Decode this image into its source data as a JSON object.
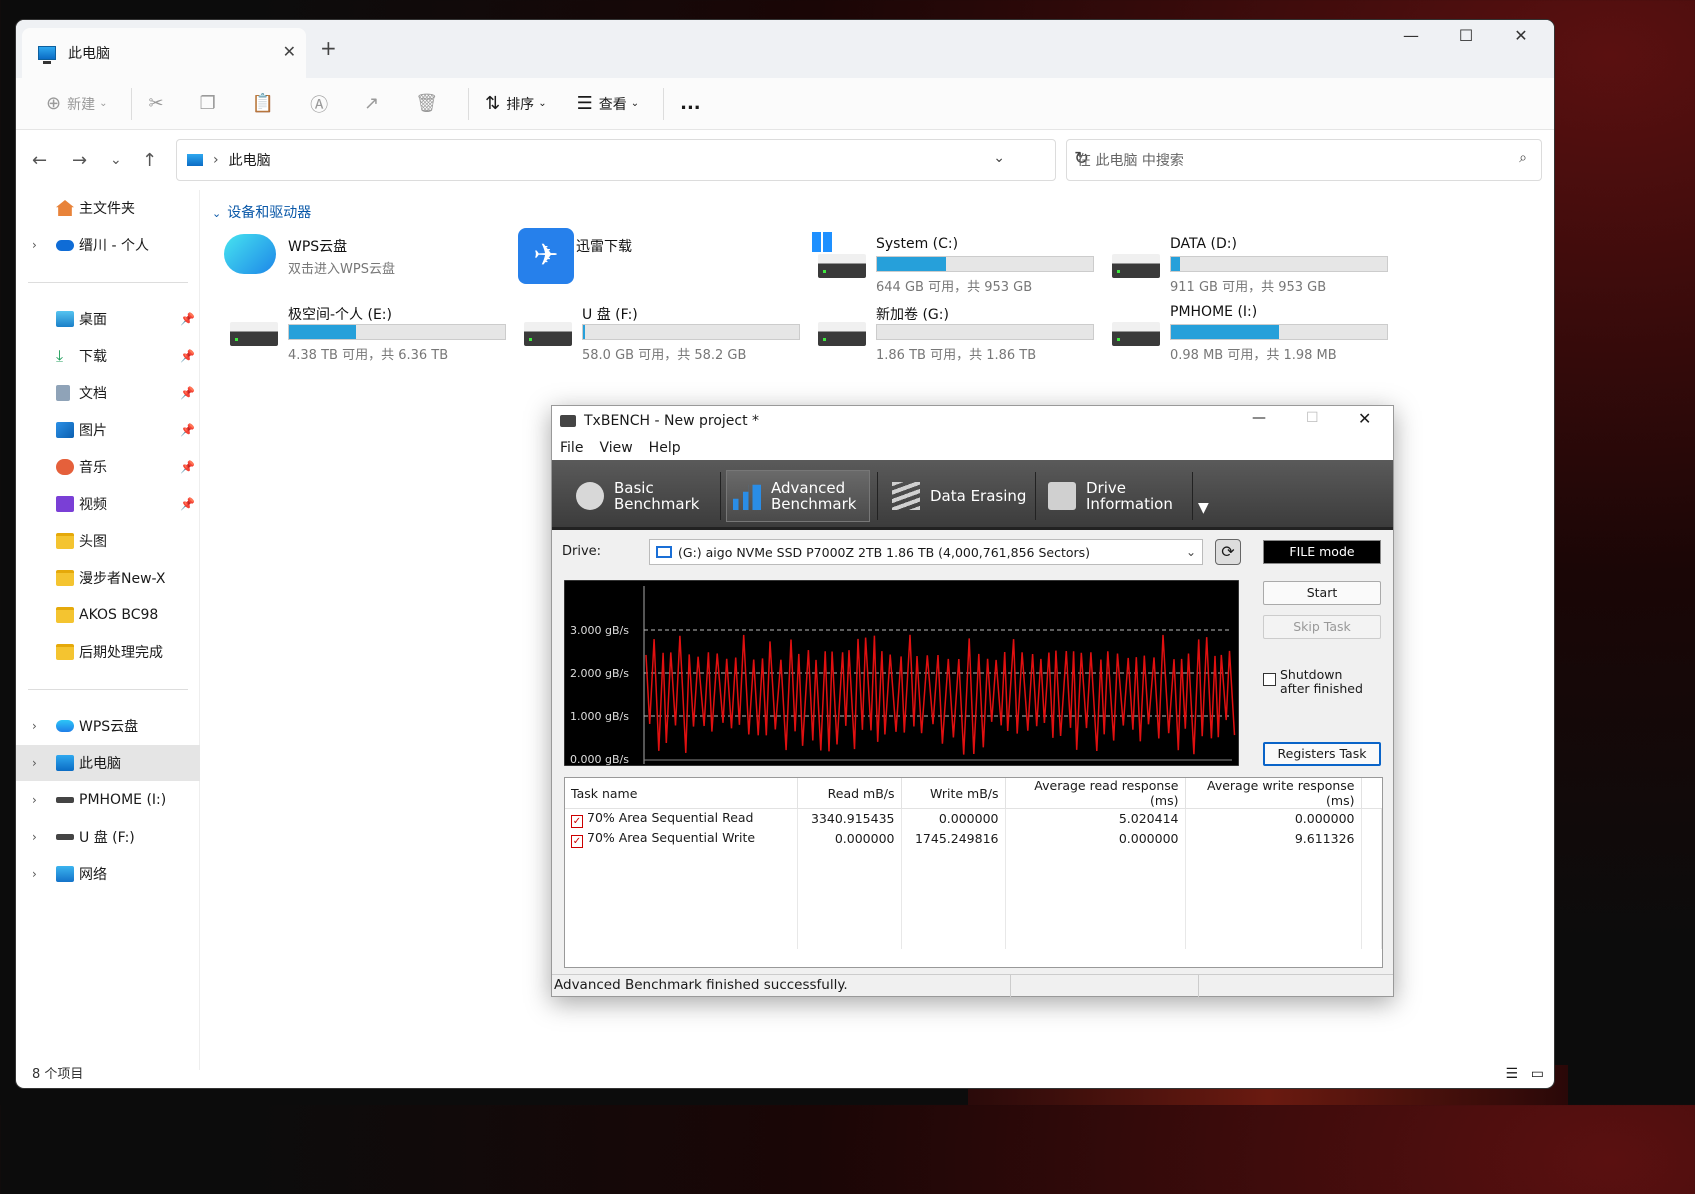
{
  "explorer": {
    "tab_title": "此电脑",
    "toolbar": {
      "new_label": "新建",
      "sort_label": "排序",
      "view_label": "查看",
      "more_label": "..."
    },
    "address": "此电脑",
    "search_placeholder": "在 此电脑 中搜索",
    "sidebar": {
      "top": [
        {
          "label": "主文件夹"
        },
        {
          "label": "缙川 - 个人"
        }
      ],
      "quick": [
        {
          "label": "桌面"
        },
        {
          "label": "下载"
        },
        {
          "label": "文档"
        },
        {
          "label": "图片"
        },
        {
          "label": "音乐"
        },
        {
          "label": "视频"
        },
        {
          "label": "头图"
        },
        {
          "label": "漫步者New-X"
        },
        {
          "label": "AKOS BC98"
        },
        {
          "label": "后期处理完成"
        }
      ],
      "bottom": [
        {
          "label": "WPS云盘"
        },
        {
          "label": "此电脑"
        },
        {
          "label": "PMHOME (I:)"
        },
        {
          "label": "U 盘 (F:)"
        },
        {
          "label": "网络"
        }
      ]
    },
    "group_title": "设备和驱动器",
    "devices": [
      {
        "name": "WPS云盘",
        "caption": "双击进入WPS云盘"
      },
      {
        "name": "迅雷下载",
        "caption": ""
      },
      {
        "name": "System (C:)",
        "caption": "644 GB 可用，共 953 GB",
        "used_fraction": 0.32
      },
      {
        "name": "DATA (D:)",
        "caption": "911 GB 可用，共 953 GB",
        "used_fraction": 0.04
      },
      {
        "name": "极空间-个人 (E:)",
        "caption": "4.38 TB 可用，共 6.36 TB",
        "used_fraction": 0.31
      },
      {
        "name": "U 盘 (F:)",
        "caption": "58.0 GB 可用，共 58.2 GB",
        "used_fraction": 0.003
      },
      {
        "name": "新加卷 (G:)",
        "caption": "1.86 TB 可用，共 1.86 TB",
        "used_fraction": 0.0
      },
      {
        "name": "PMHOME (I:)",
        "caption": "0.98 MB 可用，共 1.98 MB",
        "used_fraction": 0.5
      }
    ],
    "status": "8 个项目",
    "accent": "#26a0da"
  },
  "txbench": {
    "title": "TxBENCH - New project *",
    "menu": [
      "File",
      "View",
      "Help"
    ],
    "tabs": [
      {
        "line1": "Basic",
        "line2": "Benchmark"
      },
      {
        "line1": "Advanced",
        "line2": "Benchmark"
      },
      {
        "line1": "Data Erasing",
        "line2": ""
      },
      {
        "line1": "Drive",
        "line2": "Information"
      }
    ],
    "drive_label": "Drive:",
    "drive_value": "(G:) aigo NVMe SSD P7000Z 2TB  1.86 TB (4,000,761,856 Sectors)",
    "file_mode": "FILE mode",
    "start": "Start",
    "skip": "Skip Task",
    "shutdown_line1": "Shutdown",
    "shutdown_line2": "after finished",
    "registers": "Registers Task",
    "graph_labels": [
      "3.000 gB/s",
      "2.000 gB/s",
      "1.000 gB/s",
      "0.000 gB/s"
    ],
    "table_headers": [
      "Task name",
      "Read mB/s",
      "Write mB/s",
      "Average read response (ms)",
      "Average write response (ms)"
    ],
    "rows": [
      [
        "70%  Area Sequential Read",
        "3340.915435",
        "0.000000",
        "5.020414",
        "0.000000"
      ],
      [
        "70%  Area Sequential Write",
        "0.000000",
        "1745.249816",
        "0.000000",
        "9.611326"
      ]
    ],
    "status": "Advanced Benchmark finished successfully."
  }
}
